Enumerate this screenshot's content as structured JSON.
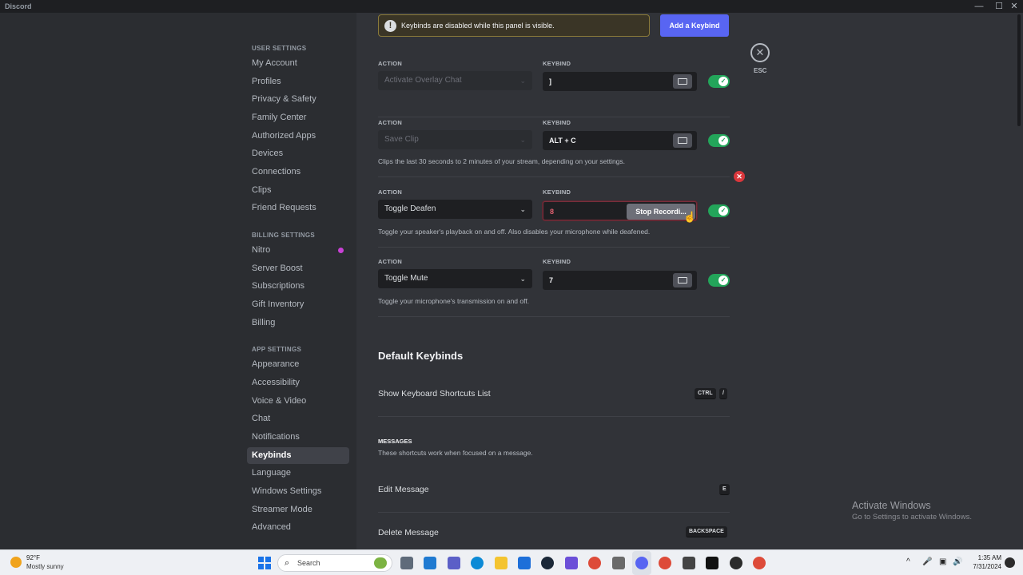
{
  "window": {
    "title": "Discord",
    "controls": {
      "minimize": "—",
      "maximize": "☐",
      "close": "✕"
    }
  },
  "sidebar": {
    "sections": [
      {
        "header": "USER SETTINGS",
        "items": [
          "My Account",
          "Profiles",
          "Privacy & Safety",
          "Family Center",
          "Authorized Apps",
          "Devices",
          "Connections",
          "Clips",
          "Friend Requests"
        ]
      },
      {
        "header": "BILLING SETTINGS",
        "items": [
          "Nitro",
          "Server Boost",
          "Subscriptions",
          "Gift Inventory",
          "Billing"
        ]
      },
      {
        "header": "APP SETTINGS",
        "items": [
          "Appearance",
          "Accessibility",
          "Voice & Video",
          "Chat",
          "Notifications",
          "Keybinds",
          "Language",
          "Windows Settings",
          "Streamer Mode",
          "Advanced"
        ]
      }
    ],
    "selected": "Keybinds",
    "nitro_dot_color": "#c941d6"
  },
  "notice": {
    "icon": "!",
    "text": "Keybinds are disabled while this panel is visible."
  },
  "add_button": "Add a Keybind",
  "esc": {
    "icon": "✕",
    "label": "ESC"
  },
  "keybinds": [
    {
      "action_label": "ACTION",
      "keybind_label": "KEYBIND",
      "action": "Activate Overlay Chat",
      "action_disabled": true,
      "keybind": "]",
      "recording": false,
      "enabled": true,
      "description": ""
    },
    {
      "action_label": "ACTION",
      "keybind_label": "KEYBIND",
      "action": "Save Clip",
      "action_disabled": true,
      "keybind": "ALT + C",
      "recording": false,
      "enabled": true,
      "description": "Clips the last 30 seconds to 2 minutes of your stream, depending on your settings."
    },
    {
      "action_label": "ACTION",
      "keybind_label": "KEYBIND",
      "action": "Toggle Deafen",
      "action_disabled": false,
      "keybind": "8",
      "recording": true,
      "stop_label": "Stop Recordi...",
      "enabled": true,
      "description": "Toggle your speaker's playback on and off. Also disables your microphone while deafened."
    },
    {
      "action_label": "ACTION",
      "keybind_label": "KEYBIND",
      "action": "Toggle Mute",
      "action_disabled": false,
      "keybind": "7",
      "recording": false,
      "enabled": true,
      "description": "Toggle your microphone's transmission on and off."
    }
  ],
  "remove_icon": "✕",
  "default_keybinds": {
    "title": "Default Keybinds",
    "rows": [
      {
        "label": "Show Keyboard Shortcuts List",
        "keys": [
          "CTRL",
          "/"
        ]
      }
    ],
    "messages_header": "MESSAGES",
    "messages_desc": "These shortcuts work when focused on a message.",
    "message_rows": [
      {
        "label": "Edit Message",
        "keys": [
          "E"
        ]
      },
      {
        "label": "Delete Message",
        "keys": [
          "BACKSPACE"
        ]
      }
    ]
  },
  "watermark": {
    "title": "Activate Windows",
    "subtitle": "Go to Settings to activate Windows."
  },
  "taskbar": {
    "weather_temp": "92°F",
    "weather_desc": "Mostly sunny",
    "search_placeholder": "Search",
    "time": "1:35 AM",
    "date": "7/31/2024",
    "app_icons": [
      "folder-icon",
      "mail-icon",
      "teams-icon",
      "edge-icon",
      "file-explorer-icon",
      "vpn-icon",
      "steam-icon",
      "copilot-icon",
      "chrome-icon",
      "app-icon",
      "discord-icon",
      "chrome-profile-icon",
      "media-icon",
      "terminal-icon",
      "obs-icon",
      "chrome-alt-icon"
    ],
    "app_colors": [
      "#5f6b7a",
      "#1f7ad1",
      "#5b5fc7",
      "#0c8ad6",
      "#f4c430",
      "#1e6fd9",
      "#1b2838",
      "#6b4fd8",
      "#dd4b39",
      "#6a6a6a",
      "#5865f2",
      "#dd4b39",
      "#444444",
      "#111111",
      "#2b2b2b",
      "#dd4b39"
    ],
    "tray_icons": [
      "^",
      "🎤",
      "▣",
      "🔊"
    ]
  }
}
